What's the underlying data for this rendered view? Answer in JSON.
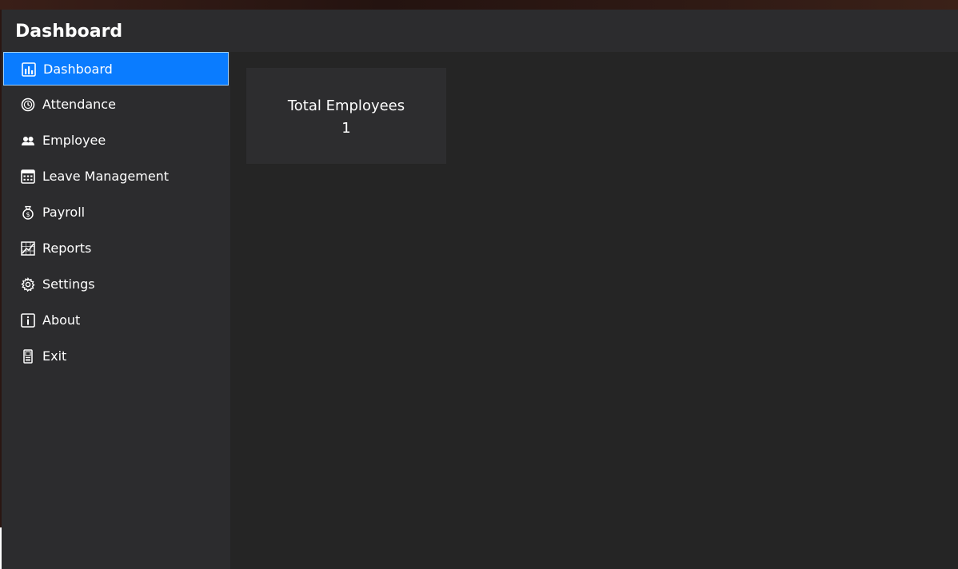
{
  "window": {
    "title": "Dashboard"
  },
  "sidebar": {
    "items": [
      {
        "label": "Dashboard",
        "icon": "bar-chart-icon",
        "active": true
      },
      {
        "label": "Attendance",
        "icon": "clock-icon",
        "active": false
      },
      {
        "label": "Employee",
        "icon": "users-icon",
        "active": false
      },
      {
        "label": "Leave Management",
        "icon": "calendar-icon",
        "active": false
      },
      {
        "label": "Payroll",
        "icon": "money-bag-icon",
        "active": false
      },
      {
        "label": "Reports",
        "icon": "line-chart-icon",
        "active": false
      },
      {
        "label": "Settings",
        "icon": "gear-icon",
        "active": false
      },
      {
        "label": "About",
        "icon": "info-icon",
        "active": false
      },
      {
        "label": "Exit",
        "icon": "exit-door-icon",
        "active": false
      }
    ]
  },
  "main": {
    "cards": [
      {
        "title": "Total Employees",
        "value": "1"
      }
    ]
  },
  "colors": {
    "accent": "#0a7cff",
    "sidebar_bg": "#2c2c2e",
    "main_bg": "#252525",
    "card_bg": "#2d2d2f",
    "text": "#ffffff"
  }
}
